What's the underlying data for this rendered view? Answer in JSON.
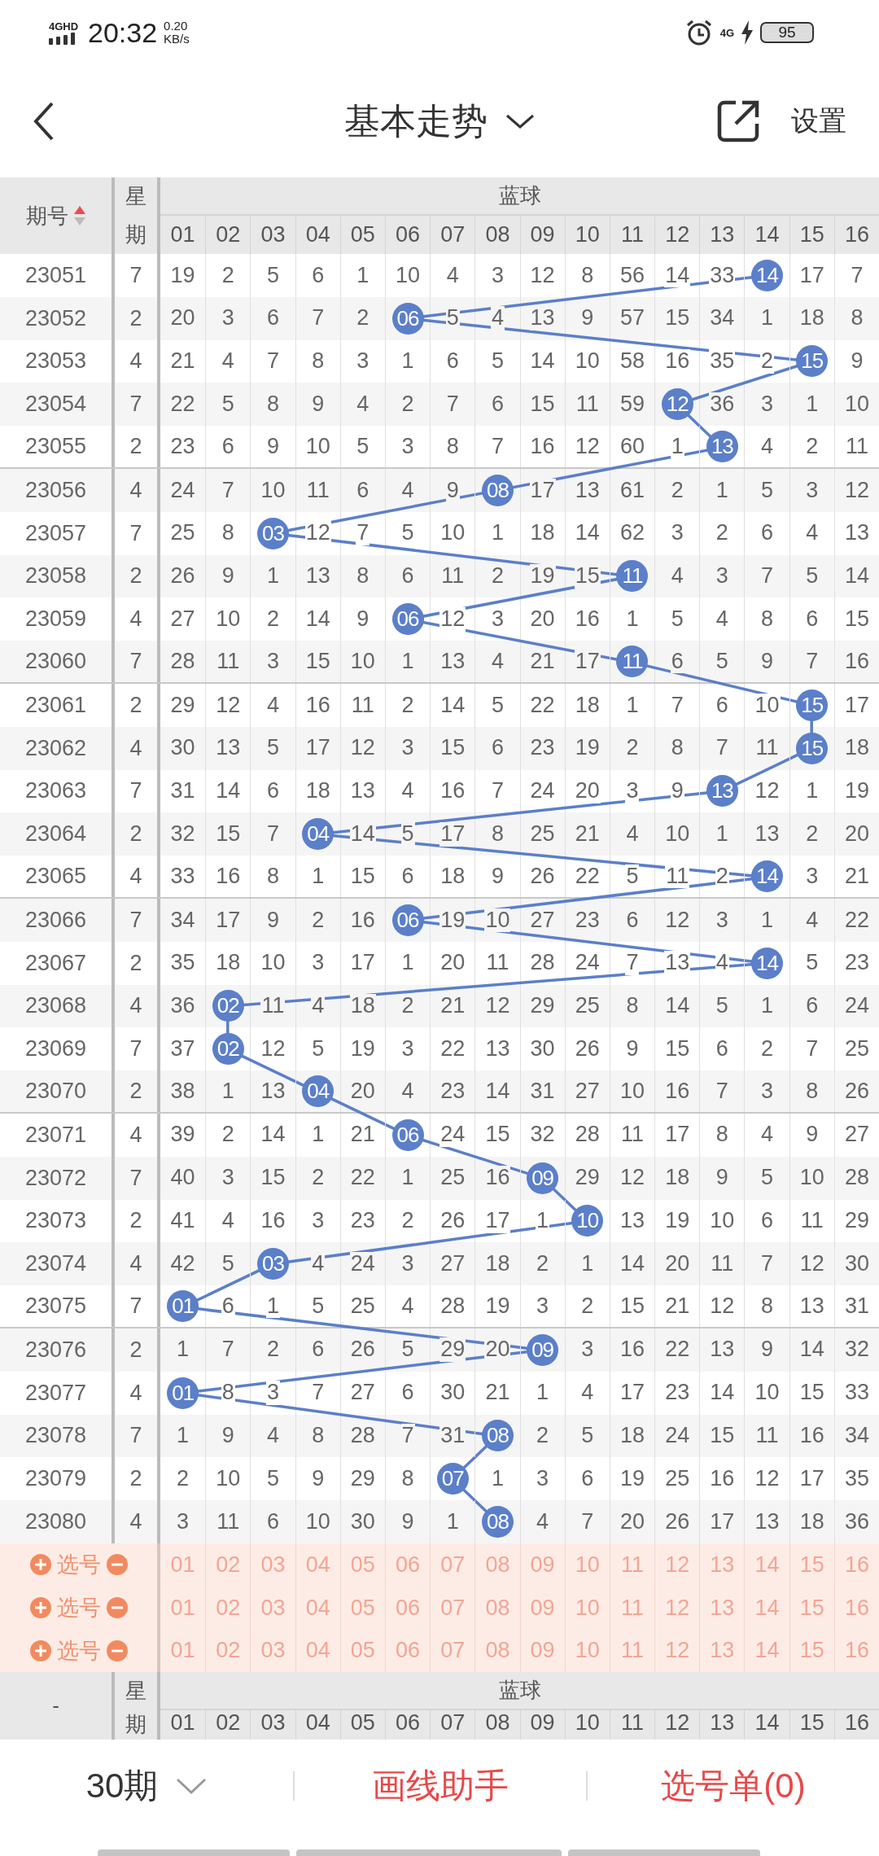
{
  "status_bar": {
    "network": "4GHD",
    "time": "20:32",
    "speed": "0.20",
    "speed_unit": "KB/s",
    "network_right": "4G",
    "battery": "95"
  },
  "app_bar": {
    "title": "基本走势",
    "action": "设置"
  },
  "table": {
    "header": {
      "issue": "期号",
      "ascending": true,
      "weekday_top": "星",
      "weekday_bottom": "期",
      "group": "蓝球",
      "columns": [
        "01",
        "02",
        "03",
        "04",
        "05",
        "06",
        "07",
        "08",
        "09",
        "10",
        "11",
        "12",
        "13",
        "14",
        "15",
        "16"
      ]
    },
    "rows": [
      {
        "issue": "23051",
        "weekday": "7",
        "cells": [
          "19",
          "2",
          "5",
          "6",
          "1",
          "10",
          "4",
          "3",
          "12",
          "8",
          "56",
          "14",
          "33",
          {
            "kind": "ball",
            "text": "14"
          },
          "17",
          "7"
        ]
      },
      {
        "issue": "23052",
        "weekday": "2",
        "cells": [
          "20",
          "3",
          "6",
          "7",
          "2",
          {
            "kind": "ball",
            "text": "06"
          },
          "5",
          "4",
          "13",
          "9",
          "57",
          "15",
          "34",
          "1",
          "18",
          "8"
        ]
      },
      {
        "issue": "23053",
        "weekday": "4",
        "cells": [
          "21",
          "4",
          "7",
          "8",
          "3",
          "1",
          "6",
          "5",
          "14",
          "10",
          "58",
          "16",
          "35",
          "2",
          {
            "kind": "ball",
            "text": "15"
          },
          "9"
        ]
      },
      {
        "issue": "23054",
        "weekday": "7",
        "cells": [
          "22",
          "5",
          "8",
          "9",
          "4",
          "2",
          "7",
          "6",
          "15",
          "11",
          "59",
          {
            "kind": "ball",
            "text": "12"
          },
          "36",
          "3",
          "1",
          "10"
        ]
      },
      {
        "issue": "23055",
        "weekday": "2",
        "cells": [
          "23",
          "6",
          "9",
          "10",
          "5",
          "3",
          "8",
          "7",
          "16",
          "12",
          "60",
          "1",
          {
            "kind": "ball",
            "text": "13"
          },
          "4",
          "2",
          "11"
        ]
      },
      {
        "issue": "23056",
        "weekday": "4",
        "cells": [
          "24",
          "7",
          "10",
          "11",
          "6",
          "4",
          "9",
          {
            "kind": "ball",
            "text": "08"
          },
          "17",
          "13",
          "61",
          "2",
          "1",
          "5",
          "3",
          "12"
        ]
      },
      {
        "issue": "23057",
        "weekday": "7",
        "cells": [
          "25",
          "8",
          {
            "kind": "ball",
            "text": "03"
          },
          "12",
          "7",
          "5",
          "10",
          "1",
          "18",
          "14",
          "62",
          "3",
          "2",
          "6",
          "4",
          "13"
        ]
      },
      {
        "issue": "23058",
        "weekday": "2",
        "cells": [
          "26",
          "9",
          "1",
          "13",
          "8",
          "6",
          "11",
          "2",
          "19",
          "15",
          {
            "kind": "ball",
            "text": "11"
          },
          "4",
          "3",
          "7",
          "5",
          "14"
        ]
      },
      {
        "issue": "23059",
        "weekday": "4",
        "cells": [
          "27",
          "10",
          "2",
          "14",
          "9",
          {
            "kind": "ball",
            "text": "06"
          },
          "12",
          "3",
          "20",
          "16",
          "1",
          "5",
          "4",
          "8",
          "6",
          "15"
        ]
      },
      {
        "issue": "23060",
        "weekday": "7",
        "cells": [
          "28",
          "11",
          "3",
          "15",
          "10",
          "1",
          "13",
          "4",
          "21",
          "17",
          {
            "kind": "ball",
            "text": "11"
          },
          "6",
          "5",
          "9",
          "7",
          "16"
        ]
      },
      {
        "issue": "23061",
        "weekday": "2",
        "cells": [
          "29",
          "12",
          "4",
          "16",
          "11",
          "2",
          "14",
          "5",
          "22",
          "18",
          "1",
          "7",
          "6",
          "10",
          {
            "kind": "ball",
            "text": "15"
          },
          "17"
        ]
      },
      {
        "issue": "23062",
        "weekday": "4",
        "cells": [
          "30",
          "13",
          "5",
          "17",
          "12",
          "3",
          "15",
          "6",
          "23",
          "19",
          "2",
          "8",
          "7",
          "11",
          {
            "kind": "ball",
            "text": "15"
          },
          "18"
        ]
      },
      {
        "issue": "23063",
        "weekday": "7",
        "cells": [
          "31",
          "14",
          "6",
          "18",
          "13",
          "4",
          "16",
          "7",
          "24",
          "20",
          "3",
          "9",
          {
            "kind": "ball",
            "text": "13"
          },
          "12",
          "1",
          "19"
        ]
      },
      {
        "issue": "23064",
        "weekday": "2",
        "cells": [
          "32",
          "15",
          "7",
          {
            "kind": "ball",
            "text": "04"
          },
          "14",
          "5",
          "17",
          "8",
          "25",
          "21",
          "4",
          "10",
          "1",
          "13",
          "2",
          "20"
        ]
      },
      {
        "issue": "23065",
        "weekday": "4",
        "cells": [
          "33",
          "16",
          "8",
          "1",
          "15",
          "6",
          "18",
          "9",
          "26",
          "22",
          "5",
          "11",
          "2",
          {
            "kind": "ball",
            "text": "14"
          },
          "3",
          "21"
        ]
      },
      {
        "issue": "23066",
        "weekday": "7",
        "cells": [
          "34",
          "17",
          "9",
          "2",
          "16",
          {
            "kind": "ball",
            "text": "06"
          },
          "19",
          "10",
          "27",
          "23",
          "6",
          "12",
          "3",
          "1",
          "4",
          "22"
        ]
      },
      {
        "issue": "23067",
        "weekday": "2",
        "cells": [
          "35",
          "18",
          "10",
          "3",
          "17",
          "1",
          "20",
          "11",
          "28",
          "24",
          "7",
          "13",
          "4",
          {
            "kind": "ball",
            "text": "14"
          },
          "5",
          "23"
        ]
      },
      {
        "issue": "23068",
        "weekday": "4",
        "cells": [
          "36",
          {
            "kind": "ball",
            "text": "02"
          },
          "11",
          "4",
          "18",
          "2",
          "21",
          "12",
          "29",
          "25",
          "8",
          "14",
          "5",
          "1",
          "6",
          "24"
        ]
      },
      {
        "issue": "23069",
        "weekday": "7",
        "cells": [
          "37",
          {
            "kind": "ball",
            "text": "02"
          },
          "12",
          "5",
          "19",
          "3",
          "22",
          "13",
          "30",
          "26",
          "9",
          "15",
          "6",
          "2",
          "7",
          "25"
        ]
      },
      {
        "issue": "23070",
        "weekday": "2",
        "cells": [
          "38",
          "1",
          "13",
          {
            "kind": "ball",
            "text": "04"
          },
          "20",
          "4",
          "23",
          "14",
          "31",
          "27",
          "10",
          "16",
          "7",
          "3",
          "8",
          "26"
        ]
      },
      {
        "issue": "23071",
        "weekday": "4",
        "cells": [
          "39",
          "2",
          "14",
          "1",
          "21",
          {
            "kind": "ball",
            "text": "06"
          },
          "24",
          "15",
          "32",
          "28",
          "11",
          "17",
          "8",
          "4",
          "9",
          "27"
        ]
      },
      {
        "issue": "23072",
        "weekday": "7",
        "cells": [
          "40",
          "3",
          "15",
          "2",
          "22",
          "1",
          "25",
          "16",
          {
            "kind": "ball",
            "text": "09"
          },
          "29",
          "12",
          "18",
          "9",
          "5",
          "10",
          "28"
        ]
      },
      {
        "issue": "23073",
        "weekday": "2",
        "cells": [
          "41",
          "4",
          "16",
          "3",
          "23",
          "2",
          "26",
          "17",
          "1",
          {
            "kind": "ball",
            "text": "10"
          },
          "13",
          "19",
          "10",
          "6",
          "11",
          "29"
        ]
      },
      {
        "issue": "23074",
        "weekday": "4",
        "cells": [
          "42",
          "5",
          {
            "kind": "ball",
            "text": "03"
          },
          "4",
          "24",
          "3",
          "27",
          "18",
          "2",
          "1",
          "14",
          "20",
          "11",
          "7",
          "12",
          "30"
        ]
      },
      {
        "issue": "23075",
        "weekday": "7",
        "cells": [
          {
            "kind": "ball",
            "text": "01"
          },
          "6",
          "1",
          "5",
          "25",
          "4",
          "28",
          "19",
          "3",
          "2",
          "15",
          "21",
          "12",
          "8",
          "13",
          "31"
        ]
      },
      {
        "issue": "23076",
        "weekday": "2",
        "cells": [
          "1",
          "7",
          "2",
          "6",
          "26",
          "5",
          "29",
          "20",
          {
            "kind": "ball",
            "text": "09"
          },
          "3",
          "16",
          "22",
          "13",
          "9",
          "14",
          "32"
        ]
      },
      {
        "issue": "23077",
        "weekday": "4",
        "cells": [
          {
            "kind": "ball",
            "text": "01"
          },
          "8",
          "3",
          "7",
          "27",
          "6",
          "30",
          "21",
          "1",
          "4",
          "17",
          "23",
          "14",
          "10",
          "15",
          "33"
        ]
      },
      {
        "issue": "23078",
        "weekday": "7",
        "cells": [
          "1",
          "9",
          "4",
          "8",
          "28",
          "7",
          "31",
          {
            "kind": "ball",
            "text": "08"
          },
          "2",
          "5",
          "18",
          "24",
          "15",
          "11",
          "16",
          "34"
        ]
      },
      {
        "issue": "23079",
        "weekday": "2",
        "cells": [
          "2",
          "10",
          "5",
          "9",
          "29",
          "8",
          {
            "kind": "ball",
            "text": "07"
          },
          "1",
          "3",
          "6",
          "19",
          "25",
          "16",
          "12",
          "17",
          "35"
        ]
      },
      {
        "issue": "23080",
        "weekday": "4",
        "cells": [
          "3",
          "11",
          "6",
          "10",
          "30",
          "9",
          "1",
          {
            "kind": "ball",
            "text": "08"
          },
          "4",
          "7",
          "20",
          "26",
          "17",
          "13",
          "18",
          "36"
        ]
      }
    ],
    "select_rows": [
      {
        "label": "选号",
        "numbers": [
          "01",
          "02",
          "03",
          "04",
          "05",
          "06",
          "07",
          "08",
          "09",
          "10",
          "11",
          "12",
          "13",
          "14",
          "15",
          "16"
        ]
      },
      {
        "label": "选号",
        "numbers": [
          "01",
          "02",
          "03",
          "04",
          "05",
          "06",
          "07",
          "08",
          "09",
          "10",
          "11",
          "12",
          "13",
          "14",
          "15",
          "16"
        ]
      },
      {
        "label": "选号",
        "numbers": [
          "01",
          "02",
          "03",
          "04",
          "05",
          "06",
          "07",
          "08",
          "09",
          "10",
          "11",
          "12",
          "13",
          "14",
          "15",
          "16"
        ]
      }
    ],
    "footer_header": {
      "issue": "-",
      "weekday_top": "星",
      "weekday_bottom": "期",
      "group": "蓝球",
      "columns": [
        "01",
        "02",
        "03",
        "04",
        "05",
        "06",
        "07",
        "08",
        "09",
        "10",
        "11",
        "12",
        "13",
        "14",
        "15",
        "16"
      ]
    }
  },
  "bottom_bar": {
    "period": "30期",
    "draw_helper": "画线助手",
    "pick_list": "选号单(0)"
  }
}
